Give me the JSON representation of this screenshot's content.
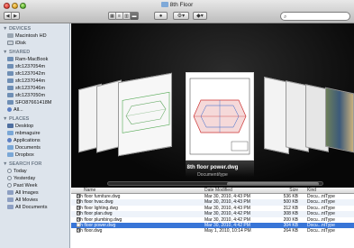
{
  "window": {
    "title": "8th Floor"
  },
  "toolbar": {
    "back_label": "◀",
    "forward_label": "▶",
    "view_modes": [
      "icon-view",
      "list-view",
      "column-view",
      "coverflow-view"
    ],
    "eye_label": "👁",
    "action_label": "⚙▾",
    "share_label": "▾",
    "search_placeholder": ""
  },
  "sidebar": {
    "sections": [
      {
        "title": "▼ DEVICES",
        "items": [
          {
            "label": "Macintosh HD",
            "icon": "hard-drive-icon"
          },
          {
            "label": "iDisk",
            "icon": "idisk-icon"
          }
        ]
      },
      {
        "title": "▼ SHARED",
        "items": [
          {
            "label": "Ram-MacBook",
            "icon": "computer-icon"
          },
          {
            "label": "sfc1237054m",
            "icon": "computer-icon"
          },
          {
            "label": "sfc1237042m",
            "icon": "computer-icon"
          },
          {
            "label": "sfc1237044m",
            "icon": "computer-icon"
          },
          {
            "label": "sfc1237046m",
            "icon": "computer-icon"
          },
          {
            "label": "sfc1237050m",
            "icon": "computer-icon"
          },
          {
            "label": "SFO87661418M",
            "icon": "computer-icon"
          },
          {
            "label": "All...",
            "icon": "globe-icon"
          }
        ]
      },
      {
        "title": "▼ PLACES",
        "items": [
          {
            "label": "Desktop",
            "icon": "desktop-icon"
          },
          {
            "label": "mbmaguire",
            "icon": "home-icon"
          },
          {
            "label": "Applications",
            "icon": "applications-icon"
          },
          {
            "label": "Documents",
            "icon": "documents-icon"
          },
          {
            "label": "Dropbox",
            "icon": "dropbox-icon"
          }
        ]
      },
      {
        "title": "▼ SEARCH FOR",
        "items": [
          {
            "label": "Today",
            "icon": "clock-icon"
          },
          {
            "label": "Yesterday",
            "icon": "clock-icon"
          },
          {
            "label": "Past Week",
            "icon": "clock-icon"
          },
          {
            "label": "All Images",
            "icon": "smart-folder-icon"
          },
          {
            "label": "All Movies",
            "icon": "smart-folder-icon"
          },
          {
            "label": "All Documents",
            "icon": "smart-folder-icon"
          }
        ]
      }
    ]
  },
  "coverflow": {
    "selected_name": "8th floor power.dwg",
    "selected_kind": "Document/type"
  },
  "list": {
    "columns": {
      "name": "Name",
      "date": "Date Modified",
      "size": "Size",
      "kind": "Kind"
    },
    "rows": [
      {
        "name": "8th floor furniture.dwg",
        "date": "Mar 30, 2010, 4:43 PM",
        "size": "536 KB",
        "kind": "Docu...ntType",
        "selected": false
      },
      {
        "name": "8th floor hvac.dwg",
        "date": "Mar 30, 2010, 4:43 PM",
        "size": "500 KB",
        "kind": "Docu...ntType",
        "selected": false
      },
      {
        "name": "8th floor lighting.dwg",
        "date": "Mar 30, 2010, 4:43 PM",
        "size": "312 KB",
        "kind": "Docu...ntType",
        "selected": false
      },
      {
        "name": "8th floor plan.dwg",
        "date": "Mar 30, 2010, 4:42 PM",
        "size": "308 KB",
        "kind": "Docu...ntType",
        "selected": false
      },
      {
        "name": "8th floor plumbing.dwg",
        "date": "Mar 30, 2010, 4:42 PM",
        "size": "200 KB",
        "kind": "Docu...ntType",
        "selected": false
      },
      {
        "name": "8th floor power.dwg",
        "date": "Mar 30, 2010, 4:42 PM",
        "size": "304 KB",
        "kind": "Docu...ntType",
        "selected": true
      },
      {
        "name": "8th floor.dwg",
        "date": "May 1, 2010, 10:14 PM",
        "size": "264 KB",
        "kind": "Docu...ntType",
        "selected": false
      }
    ]
  },
  "colors": {
    "selection": "#3875d7",
    "sidebar_bg": "#dde4ec",
    "coverflow_bg": "#070707"
  }
}
